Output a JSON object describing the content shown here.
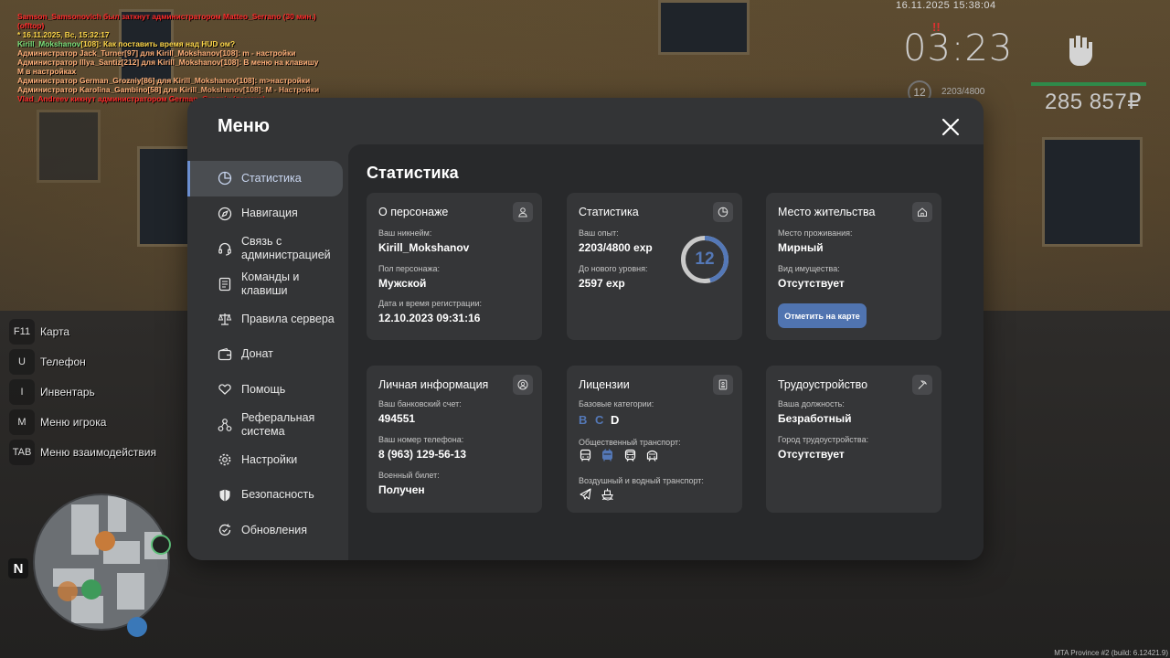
{
  "chat": [
    {
      "text": "Samson_Samsonovich был заткнут администратором Matteo_Serrano (30 мин.)",
      "color": "#ff2b2b"
    },
    {
      "text": "(offtop)",
      "color": "#ff2b2b"
    },
    {
      "text": "* 16.11.2025, Вс, 15:32:17",
      "color": "#ffd84a"
    },
    {
      "text": "Kirill_Mokshanov[108]: Как поставить время над HUD ом?",
      "color": "#ffd84a",
      "name_color": "#7be07b",
      "name": "Kirill_Mokshanov",
      "rest": "[108]: Как поставить время над HUD ом?"
    },
    {
      "text": "Администратор Jack_Turner[97] для Kirill_Mokshanov[108]: m - настройки",
      "color": "#ffb07a"
    },
    {
      "text": "Администратор Illya_Santiz[212] для Kirill_Mokshanov[108]: В меню на клавишу",
      "color": "#ffb07a"
    },
    {
      "text": " M в настройках",
      "color": "#ffb07a"
    },
    {
      "text": "Администратор German_Grozniy[86] для Kirill_Mokshanov[108]: m>настройки",
      "color": "#ffb07a"
    },
    {
      "text": "Администратор Karolina_Gambino[58] для Kirill_Mokshanov[108]: M - Настройки",
      "color": "#ffb07a"
    },
    {
      "text": "Vlad_Andreev кикнут администратором German_Grozniy (помеха)",
      "color": "#ff2b2b"
    }
  ],
  "hud": {
    "datetime": "16.11.2025 15:38:04",
    "alert": "!!",
    "clock": "03:23",
    "level": "12",
    "exp": "2203/4800",
    "money": "285 857₽",
    "accent": "#2f8a4a"
  },
  "keybinds": [
    {
      "key": "F11",
      "label": "Карта"
    },
    {
      "key": "U",
      "label": "Телефон"
    },
    {
      "key": "I",
      "label": "Инвентарь"
    },
    {
      "key": "M",
      "label": "Меню игрока"
    },
    {
      "key": "TAB",
      "label": "Меню взаимодействия"
    }
  ],
  "minimap": {
    "north": "N"
  },
  "version": "MTA Province #2 (build: 6.12421.9)",
  "menu": {
    "title": "Меню",
    "close_icon": "close-icon",
    "nav": [
      {
        "label": "Статистика",
        "icon": "pie-chart-icon",
        "active": true
      },
      {
        "label": "Навигация",
        "icon": "compass-icon"
      },
      {
        "label": "Связь с администрацией",
        "icon": "headset-icon"
      },
      {
        "label": "Команды и клавиши",
        "icon": "document-icon"
      },
      {
        "label": "Правила сервера",
        "icon": "scales-icon"
      },
      {
        "label": "Донат",
        "icon": "wallet-icon"
      },
      {
        "label": "Помощь",
        "icon": "heart-hands-icon"
      },
      {
        "label": "Реферальная система",
        "icon": "referral-icon"
      },
      {
        "label": "Настройки",
        "icon": "gear-icon"
      },
      {
        "label": "Безопасность",
        "icon": "shield-icon"
      },
      {
        "label": "Обновления",
        "icon": "refresh-icon"
      }
    ],
    "active_color": "#6c8fd0"
  },
  "stats": {
    "title": "Статистика",
    "character": {
      "title": "О персонаже",
      "icon": "user-icon",
      "nickname_label": "Ваш никнейм:",
      "nickname": "Kirill_Mokshanov",
      "gender_label": "Пол персонажа:",
      "gender": "Мужской",
      "reg_label": "Дата и время регистрации:",
      "reg": "12.10.2023 09:31:16"
    },
    "statistics": {
      "title": "Статистика",
      "icon": "pie-chart-icon",
      "exp_label": "Ваш опыт:",
      "exp": "2203/4800 exp",
      "next_label": "До нового уровня:",
      "next": "2597 exp",
      "level": "12",
      "progress": 0.459,
      "ring_color": "#5478b7"
    },
    "residence": {
      "title": "Место жительства",
      "icon": "home-icon",
      "place_label": "Место проживания:",
      "place": "Мирный",
      "property_label": "Вид имущества:",
      "property": "Отсутствует",
      "button": "Отметить на карте"
    },
    "personal": {
      "title": "Личная информация",
      "icon": "user-circle-icon",
      "bank_label": "Ваш банковский счет:",
      "bank": "494551",
      "phone_label": "Ваш номер телефона:",
      "phone": "8 (963) 129-56-13",
      "military_label": "Военный билет:",
      "military": "Получен"
    },
    "licenses": {
      "title": "Лицензии",
      "icon": "id-card-icon",
      "base_label": "Базовые категории:",
      "categories": [
        {
          "letter": "B",
          "color": "#5478b7"
        },
        {
          "letter": "C",
          "color": "#5478b7"
        },
        {
          "letter": "D",
          "color": "#ffffff"
        }
      ],
      "public_label": "Общественный транспорт:",
      "public_icons": [
        "bus-icon",
        "trolleybus-icon",
        "tram-icon",
        "train-icon"
      ],
      "air_label": "Воздушный и водный транспорт:",
      "air_icons": [
        "plane-icon",
        "ship-icon"
      ]
    },
    "employment": {
      "title": "Трудоустройство",
      "icon": "pickaxe-icon",
      "position_label": "Ваша должность:",
      "position": "Безработный",
      "city_label": "Город трудоустройства:",
      "city": "Отсутствует"
    }
  }
}
